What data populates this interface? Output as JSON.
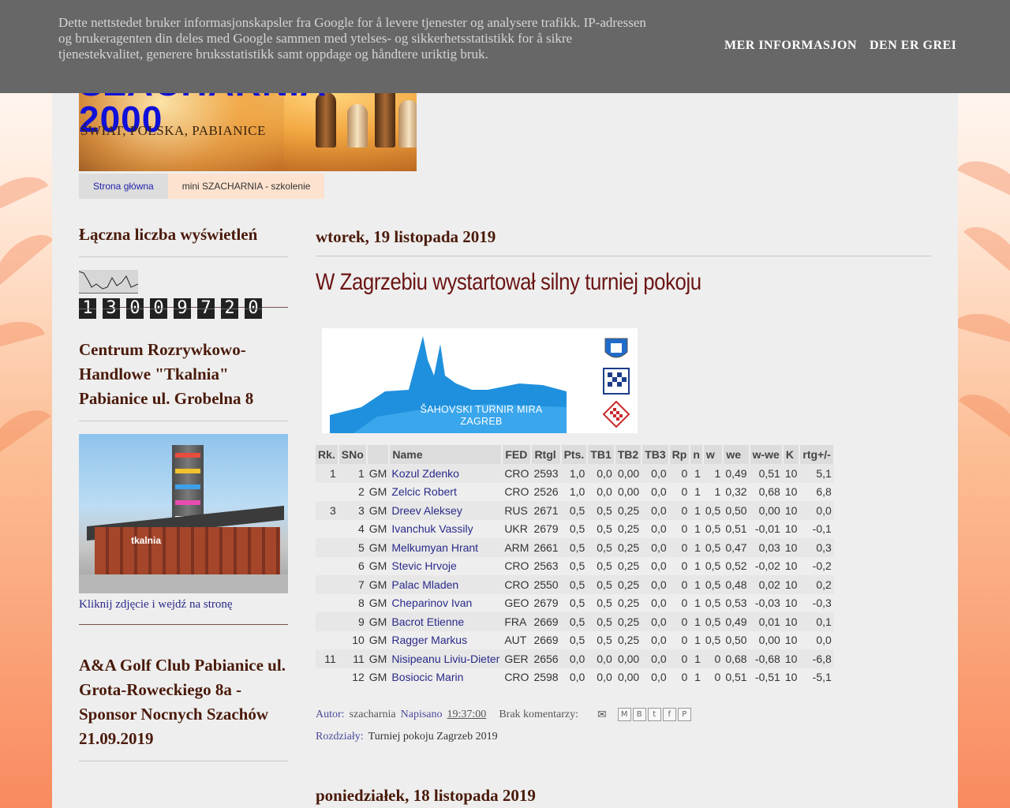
{
  "cookie_bar": {
    "text": "Dette nettstedet bruker informasjonskapsler fra Google for å levere tjenester og analysere trafikk. IP-adressen og brukeragenten din deles med Google sammen med ytelses- og sikkerhetsstatistikk for å sikre tjenestekvalitet, generere bruksstatistikk samt oppdage og håndtere uriktig bruk.",
    "more_info": "MER INFORMASJON",
    "accept": "DEN ER GREI"
  },
  "header": {
    "title": "SZACHARNIA 2000",
    "subtitle": "ŚWIAT, POLSKA, PABIANICE"
  },
  "tabs": [
    {
      "label": "Strona główna"
    },
    {
      "label": "mini SZACHARNIA - szkolenie"
    }
  ],
  "sidebar": {
    "views_title": "Łączna liczba wyświetleń",
    "counter_digits": [
      "1",
      "3",
      "0",
      "0",
      "9",
      "7",
      "2",
      "0"
    ],
    "mall_title": "Centrum Rozrywkowo-Handlowe \"Tkalnia\" Pabianice ul. Grobelna 8",
    "mall_image_label": "tkalnia",
    "mall_link": "Kliknij zdjęcie i wejdź na stronę",
    "golf_title": "A&A Golf Club Pabianice ul. Grota-Roweckiego 8a - Sponsor Nocnych Szachów 21.09.2019"
  },
  "post": {
    "date": "wtorek, 19 listopada 2019",
    "title": "W Zagrzebiu wystartował silny turniej pokoju",
    "poster_text": "ŠAHOVSKI TURNIR MIRA\nZAGREB",
    "table": {
      "headers": [
        "Rk.",
        "SNo",
        "",
        "Name",
        "FED",
        "Rtgl",
        "Pts.",
        "TB1",
        "TB2",
        "TB3",
        "Rp",
        "n",
        "w",
        "we",
        "w-we",
        "K",
        "rtg+/-"
      ],
      "rows": [
        [
          "1",
          "1",
          "GM",
          "Kozul Zdenko",
          "CRO",
          "2593",
          "1,0",
          "0,0",
          "0,00",
          "0,0",
          "0",
          "1",
          "1",
          "0,49",
          "0,51",
          "10",
          "5,1"
        ],
        [
          "",
          "2",
          "GM",
          "Zelcic Robert",
          "CRO",
          "2526",
          "1,0",
          "0,0",
          "0,00",
          "0,0",
          "0",
          "1",
          "1",
          "0,32",
          "0,68",
          "10",
          "6,8"
        ],
        [
          "3",
          "3",
          "GM",
          "Dreev Aleksey",
          "RUS",
          "2671",
          "0,5",
          "0,5",
          "0,25",
          "0,0",
          "0",
          "1",
          "0,5",
          "0,50",
          "0,00",
          "10",
          "0,0"
        ],
        [
          "",
          "4",
          "GM",
          "Ivanchuk Vassily",
          "UKR",
          "2679",
          "0,5",
          "0,5",
          "0,25",
          "0,0",
          "0",
          "1",
          "0,5",
          "0,51",
          "-0,01",
          "10",
          "-0,1"
        ],
        [
          "",
          "5",
          "GM",
          "Melkumyan Hrant",
          "ARM",
          "2661",
          "0,5",
          "0,5",
          "0,25",
          "0,0",
          "0",
          "1",
          "0,5",
          "0,47",
          "0,03",
          "10",
          "0,3"
        ],
        [
          "",
          "6",
          "GM",
          "Stevic Hrvoje",
          "CRO",
          "2563",
          "0,5",
          "0,5",
          "0,25",
          "0,0",
          "0",
          "1",
          "0,5",
          "0,52",
          "-0,02",
          "10",
          "-0,2"
        ],
        [
          "",
          "7",
          "GM",
          "Palac Mladen",
          "CRO",
          "2550",
          "0,5",
          "0,5",
          "0,25",
          "0,0",
          "0",
          "1",
          "0,5",
          "0,48",
          "0,02",
          "10",
          "0,2"
        ],
        [
          "",
          "8",
          "GM",
          "Cheparinov Ivan",
          "GEO",
          "2679",
          "0,5",
          "0,5",
          "0,25",
          "0,0",
          "0",
          "1",
          "0,5",
          "0,53",
          "-0,03",
          "10",
          "-0,3"
        ],
        [
          "",
          "9",
          "GM",
          "Bacrot Etienne",
          "FRA",
          "2669",
          "0,5",
          "0,5",
          "0,25",
          "0,0",
          "0",
          "1",
          "0,5",
          "0,49",
          "0,01",
          "10",
          "0,1"
        ],
        [
          "",
          "10",
          "GM",
          "Ragger Markus",
          "AUT",
          "2669",
          "0,5",
          "0,5",
          "0,25",
          "0,0",
          "0",
          "1",
          "0,5",
          "0,50",
          "0,00",
          "10",
          "0,0"
        ],
        [
          "11",
          "11",
          "GM",
          "Nisipeanu Liviu-Dieter",
          "GER",
          "2656",
          "0,0",
          "0,0",
          "0,00",
          "0,0",
          "0",
          "1",
          "0",
          "0,68",
          "-0,68",
          "10",
          "-6,8"
        ],
        [
          "",
          "12",
          "GM",
          "Bosiocic Marin",
          "CRO",
          "2598",
          "0,0",
          "0,0",
          "0,00",
          "0,0",
          "0",
          "1",
          "0",
          "0,51",
          "-0,51",
          "10",
          "-5,1"
        ]
      ]
    },
    "author_label": "Autor:",
    "author": "szacharnia",
    "posted_label": "Napisano",
    "time": "19:37:00",
    "comments": "Brak komentarzy:",
    "share_icons": [
      "email-icon",
      "blogger-icon",
      "twitter-icon",
      "facebook-icon",
      "pinterest-icon"
    ],
    "labels_label": "Rozdziały:",
    "labels_value": "Turniej pokoju Zagrzeb 2019"
  },
  "next_post": {
    "date": "poniedziałek, 18 listopada 2019"
  },
  "colors": {
    "cookie_bg": "#676767",
    "heading": "#4a1a0a",
    "post_title": "#6b1414",
    "link": "#2a2a8a",
    "page_bg": "#eeeeee"
  }
}
